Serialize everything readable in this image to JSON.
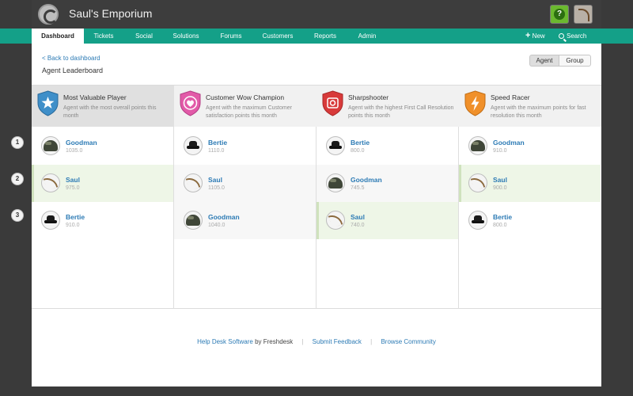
{
  "app": {
    "title": "Saul's Emporium",
    "help_label": "?"
  },
  "nav": {
    "items": [
      {
        "label": "Dashboard",
        "active": true
      },
      {
        "label": "Tickets"
      },
      {
        "label": "Social"
      },
      {
        "label": "Solutions"
      },
      {
        "label": "Forums"
      },
      {
        "label": "Customers"
      },
      {
        "label": "Reports"
      },
      {
        "label": "Admin"
      }
    ],
    "new_label": "New",
    "new_symbol": "+",
    "search_label": "Search"
  },
  "page": {
    "back_link": "< Back to dashboard",
    "title": "Agent Leaderboard",
    "toggle": {
      "agent": "Agent",
      "group": "Group"
    }
  },
  "ranks": [
    "1",
    "2",
    "3"
  ],
  "categories": [
    {
      "title": "Most Valuable Player",
      "description": "Agent with the most overall points this month",
      "badge_icon": "star-icon",
      "badge_color": "#3f8fc9",
      "agents": [
        {
          "name": "Goodman",
          "points": "1035.0",
          "avatar": "helmet"
        },
        {
          "name": "Saul",
          "points": "975.0",
          "avatar": "whip"
        },
        {
          "name": "Bertie",
          "points": "910.0",
          "avatar": "hat"
        }
      ]
    },
    {
      "title": "Customer Wow Champion",
      "description": "Agent with the maximum Customer satisfaction points this month",
      "badge_icon": "heart-icon",
      "badge_color": "#e25aa8",
      "agents": [
        {
          "name": "Bertie",
          "points": "1110.0",
          "avatar": "hat"
        },
        {
          "name": "Saul",
          "points": "1105.0",
          "avatar": "whip"
        },
        {
          "name": "Goodman",
          "points": "1040.0",
          "avatar": "helmet"
        }
      ]
    },
    {
      "title": "Sharpshooter",
      "description": "Agent with the highest First Call Resolution points this month",
      "badge_icon": "target-icon",
      "badge_color": "#d83a3a",
      "agents": [
        {
          "name": "Bertie",
          "points": "800.0",
          "avatar": "hat"
        },
        {
          "name": "Goodman",
          "points": "745.5",
          "avatar": "helmet"
        },
        {
          "name": "Saul",
          "points": "740.0",
          "avatar": "whip"
        }
      ]
    },
    {
      "title": "Speed Racer",
      "description": "Agent with the maximum points for fast resolution this month",
      "badge_icon": "lightning-icon",
      "badge_color": "#f0902a",
      "agents": [
        {
          "name": "Goodman",
          "points": "910.0",
          "avatar": "helmet"
        },
        {
          "name": "Saul",
          "points": "900.0",
          "avatar": "whip"
        },
        {
          "name": "Bertie",
          "points": "800.0",
          "avatar": "hat"
        }
      ]
    }
  ],
  "footer": {
    "software_link": "Help Desk Software",
    "by_text": " by Freshdesk",
    "feedback_link": "Submit Feedback",
    "community_link": "Browse Community",
    "separator": "|"
  }
}
